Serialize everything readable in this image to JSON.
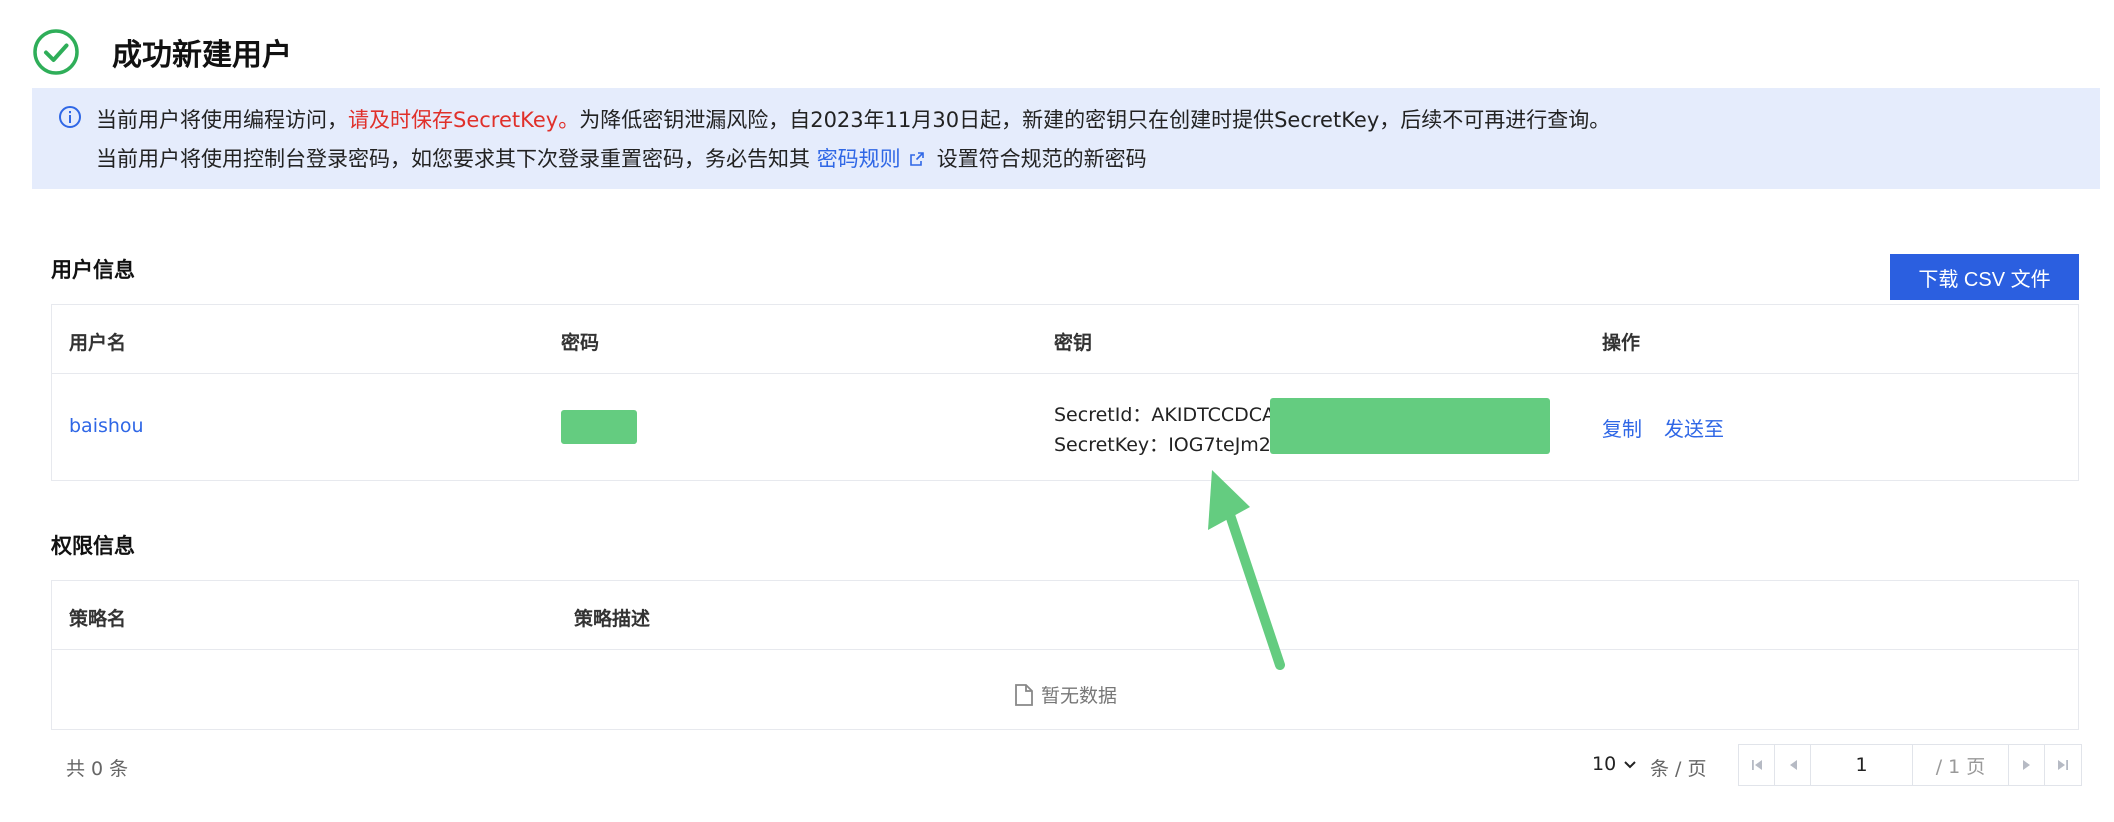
{
  "page": {
    "title": "成功新建用户"
  },
  "notice": {
    "line1_pre": "当前用户将使用编程访问，",
    "line1_warn": "请及时保存SecretKey。",
    "line1_post": "为降低密钥泄漏风险，自2023年11月30日起，新建的密钥只在创建时提供SecretKey，后续不可再进行查询。",
    "line2_pre": "当前用户将使用控制台登录密码，如您要求其下次登录重置密码，务必告知其",
    "line2_link": "密码规则",
    "line2_post": "设置符合规范的新密码"
  },
  "user_section": {
    "title": "用户信息",
    "download_button": "下载 CSV 文件",
    "columns": [
      "用户名",
      "密码",
      "密钥",
      "操作"
    ],
    "row": {
      "username": "baishou",
      "secret_id_label": "SecretId：",
      "secret_id": "AKIDTCCDCA6",
      "secret_key_label": "SecretKey：",
      "secret_key": "IOG7teJm26",
      "actions": [
        "复制",
        "发送至"
      ]
    }
  },
  "permission_section": {
    "title": "权限信息",
    "columns": [
      "策略名",
      "策略描述"
    ],
    "empty_text": "暂无数据"
  },
  "pagination": {
    "total": "共 0 条",
    "page_size": "10",
    "per_page": "条 / 页",
    "current_page": "1",
    "page_total": "/ 1 页"
  },
  "colors": {
    "accent": "#2b5fe0",
    "link": "#2f67e6",
    "warning": "#e0302a",
    "success": "#2fae59",
    "notice_bg": "#e5ecfc",
    "redaction": "#64cc80"
  }
}
